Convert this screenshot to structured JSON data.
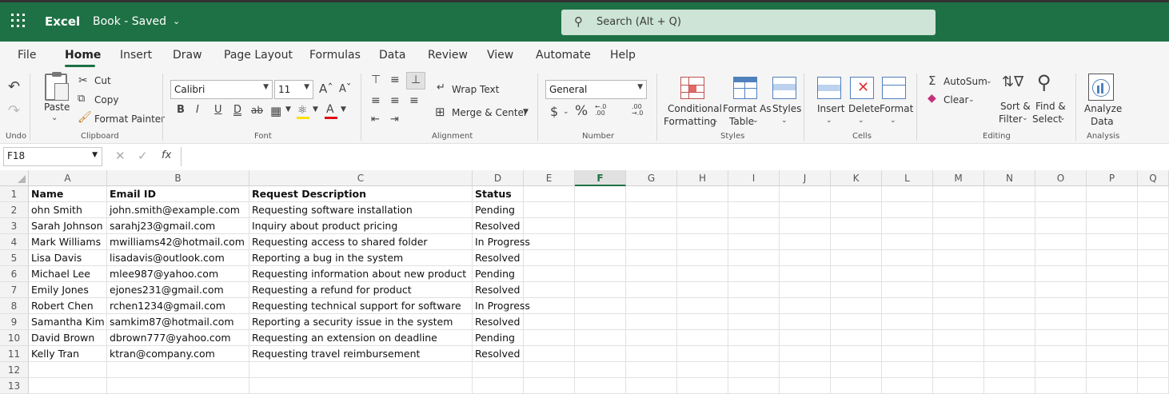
{
  "app": {
    "name": "Excel",
    "doc_title": "Book - Saved",
    "search_placeholder": "Search (Alt + Q)"
  },
  "menu": [
    "File",
    "Home",
    "Insert",
    "Draw",
    "Page Layout",
    "Formulas",
    "Data",
    "Review",
    "View",
    "Automate",
    "Help"
  ],
  "menu_active": "Home",
  "ribbon": {
    "groups": {
      "undo": "Undo",
      "clipboard": "Clipboard",
      "font": "Font",
      "alignment": "Alignment",
      "number": "Number",
      "styles": "Styles",
      "cells": "Cells",
      "editing": "Editing",
      "analysis": "Analysis"
    },
    "clipboard": {
      "paste": "Paste",
      "cut": "Cut",
      "copy": "Copy",
      "format_painter": "Format Painter"
    },
    "font": {
      "family": "Calibri",
      "size": "11",
      "bold": "B",
      "italic": "I",
      "underline": "U",
      "double_underline": "D",
      "strike": "ab"
    },
    "alignment": {
      "wrap_text": "Wrap Text",
      "merge_center": "Merge & Center"
    },
    "number": {
      "format": "General",
      "currency": "$",
      "percent": "%",
      "inc_decimal": "←.0 .00",
      "dec_decimal": ".00 →.0"
    },
    "styles": {
      "conditional_1": "Conditional",
      "conditional_2": "Formatting",
      "format_as_1": "Format As",
      "format_as_2": "Table",
      "styles": "Styles"
    },
    "cells": {
      "insert": "Insert",
      "delete": "Delete",
      "format": "Format"
    },
    "editing": {
      "autosum": "AutoSum",
      "clear": "Clear",
      "sort_1": "Sort &",
      "sort_2": "Filter",
      "find_1": "Find &",
      "find_2": "Select"
    },
    "analysis": {
      "analyze_1": "Analyze",
      "analyze_2": "Data"
    }
  },
  "formula_bar": {
    "name_box": "F18",
    "fx": "fx",
    "formula": ""
  },
  "sheet": {
    "columns": [
      "A",
      "B",
      "C",
      "D",
      "E",
      "F",
      "G",
      "H",
      "I",
      "J",
      "K",
      "L",
      "M",
      "N",
      "O",
      "P",
      "Q"
    ],
    "selected_column": "F",
    "rows": [
      "1",
      "2",
      "3",
      "4",
      "5",
      "6",
      "7",
      "8",
      "9",
      "10",
      "11",
      "12",
      "13"
    ],
    "data": [
      [
        "Name",
        "Email ID",
        "Request Description",
        "Status"
      ],
      [
        "ohn Smith",
        "john.smith@example.com",
        "Requesting software installation",
        "Pending"
      ],
      [
        "Sarah Johnson",
        "sarahj23@gmail.com",
        "Inquiry about product pricing",
        "Resolved"
      ],
      [
        "Mark Williams",
        "mwilliams42@hotmail.com",
        "Requesting access to shared folder",
        "In Progress"
      ],
      [
        "Lisa Davis",
        "lisadavis@outlook.com",
        "Reporting a bug in the system",
        "Resolved"
      ],
      [
        "Michael Lee",
        "mlee987@yahoo.com",
        "Requesting information about new product",
        "Pending"
      ],
      [
        "Emily Jones",
        "ejones231@gmail.com",
        "Requesting a refund for product",
        "Resolved"
      ],
      [
        "Robert Chen",
        "rchen1234@gmail.com",
        "Requesting technical support for software",
        "In Progress"
      ],
      [
        "Samantha Kim",
        "samkim87@hotmail.com",
        "Reporting a security issue in the system",
        "Resolved"
      ],
      [
        "David Brown",
        "dbrown777@yahoo.com",
        "Requesting an extension on deadline",
        "Pending"
      ],
      [
        "Kelly Tran",
        "ktran@company.com",
        "Requesting travel reimbursement",
        "Resolved"
      ]
    ]
  }
}
